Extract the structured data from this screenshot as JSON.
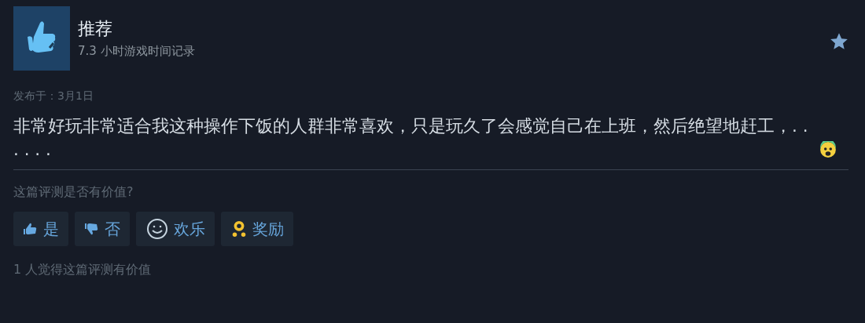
{
  "review": {
    "verdict": "推荐",
    "playtime": "7.3 小时游戏时间记录",
    "favorited": true,
    "posted": "发布于：3月1日",
    "body": "非常好玩非常适合我这种操作下饭的人群非常喜欢，只是玩久了会感觉自己在上班，然后绝望地赶工，. . . . . ."
  },
  "helpful": {
    "question": "这篇评测是否有价值?",
    "buttons": [
      {
        "kind": "up",
        "label": "是"
      },
      {
        "kind": "down",
        "label": "否"
      },
      {
        "kind": "funny",
        "label": "欢乐"
      },
      {
        "kind": "award",
        "label": "奖励"
      }
    ],
    "count": "1 人觉得这篇评测有价值"
  }
}
